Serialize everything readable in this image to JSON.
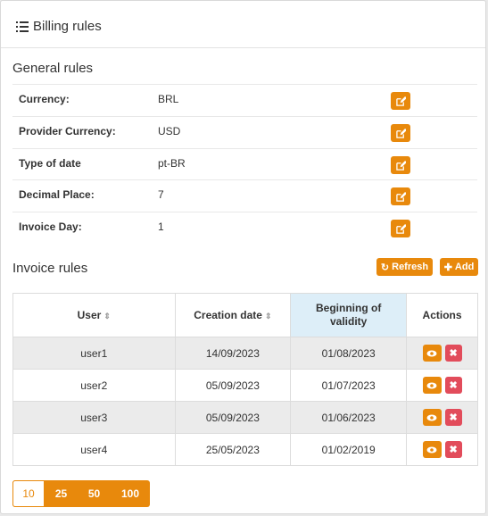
{
  "header": {
    "title": "Billing rules",
    "icon": "list-icon"
  },
  "general": {
    "title": "General rules",
    "rows": [
      {
        "label": "Currency:",
        "value": "BRL"
      },
      {
        "label": "Provider Currency:",
        "value": "USD"
      },
      {
        "label": "Type of date",
        "value": "pt-BR"
      },
      {
        "label": "Decimal Place:",
        "value": "7"
      },
      {
        "label": "Invoice Day:",
        "value": "1"
      }
    ]
  },
  "invoice": {
    "title": "Invoice rules",
    "refresh_label": "Refresh",
    "add_label": "Add",
    "columns": [
      "User",
      "Creation date",
      "Beginning of validity",
      "Actions"
    ],
    "rows": [
      {
        "user": "user1",
        "created": "14/09/2023",
        "begin": "01/08/2023"
      },
      {
        "user": "user2",
        "created": "05/09/2023",
        "begin": "01/07/2023"
      },
      {
        "user": "user3",
        "created": "05/09/2023",
        "begin": "01/06/2023"
      },
      {
        "user": "user4",
        "created": "25/05/2023",
        "begin": "01/02/2019"
      }
    ]
  },
  "pager": {
    "sizes": [
      "10",
      "25",
      "50",
      "100"
    ],
    "selected": "10"
  },
  "colors": {
    "accent": "#e8890c",
    "danger": "#e24c5b",
    "sorted_header": "#ddeef8"
  }
}
